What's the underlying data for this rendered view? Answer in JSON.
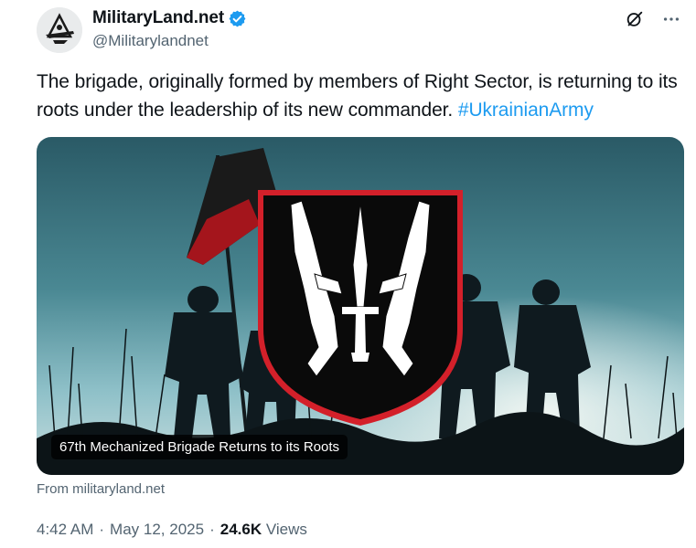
{
  "author": {
    "display_name": "MilitaryLand.net",
    "handle": "@Militarylandnet"
  },
  "tweet": {
    "text_main": "The brigade, originally formed by members of Right Sector, is returning to its roots under the leadership of its new commander. ",
    "hashtag": "#UkrainianArmy"
  },
  "card": {
    "caption": "67th Mechanized Brigade Returns to its Roots",
    "source": "From militaryland.net"
  },
  "meta": {
    "time": "4:42 AM",
    "separator": "·",
    "date": "May 12, 2025",
    "views_count": "24.6K",
    "views_label": "Views"
  },
  "icons": {
    "verified": "verified-badge-icon",
    "grok": "grok-icon",
    "more": "more-icon"
  },
  "colors": {
    "accent": "#1d9bf0",
    "secondary_text": "#536471",
    "primary_text": "#0f1419",
    "emblem_red": "#d3202a"
  }
}
